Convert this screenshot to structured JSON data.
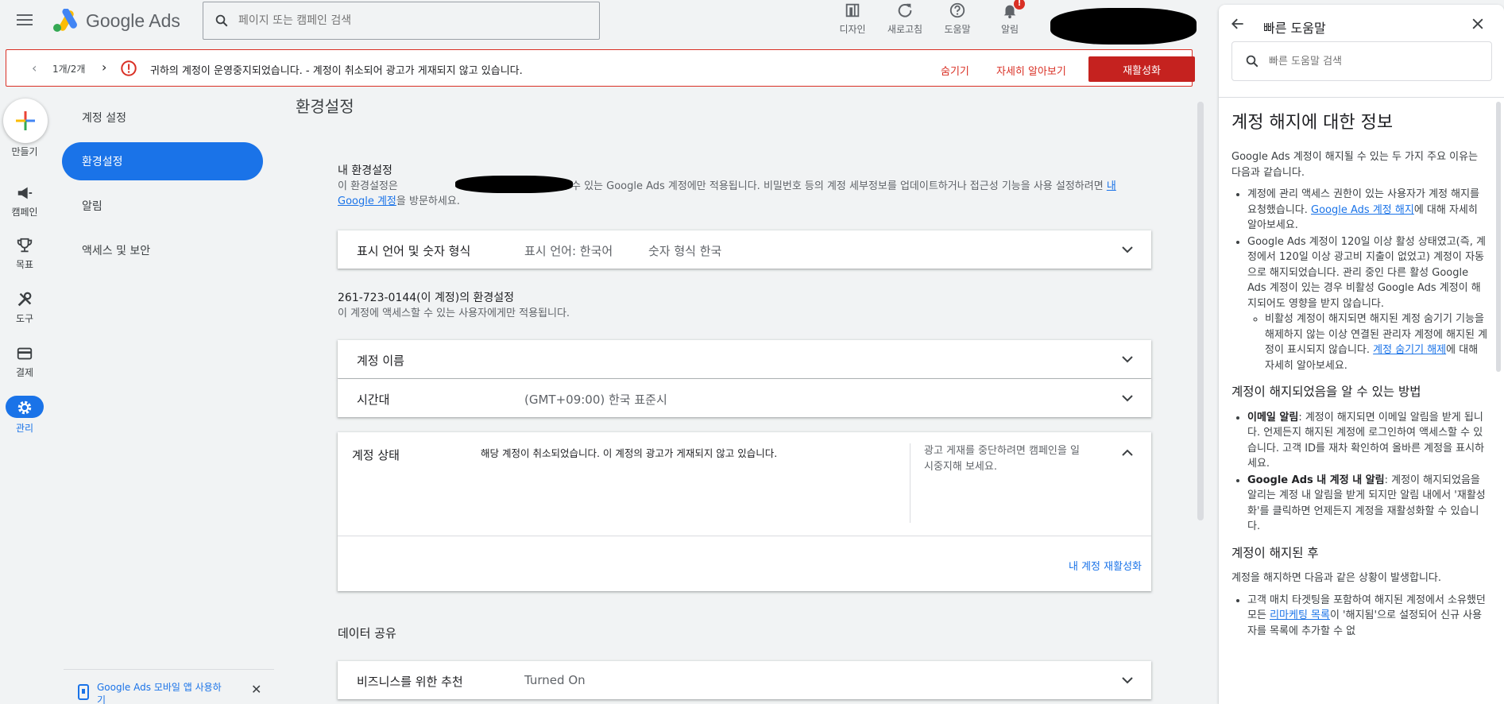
{
  "header": {
    "app_title": "Google Ads",
    "search_placeholder": "페이지 또는 캠페인 검색",
    "icons": [
      {
        "name": "appearance",
        "label": "디자인"
      },
      {
        "name": "refresh",
        "label": "새로고침"
      },
      {
        "name": "help",
        "label": "도움말"
      },
      {
        "name": "notifications",
        "label": "알림",
        "badge": "!"
      }
    ]
  },
  "alert": {
    "pager": "1개/2개",
    "message": "귀하의 계정이 운영중지되었습니다. - 계정이 취소되어 광고가 게재되지 않고 있습니다.",
    "hide": "숨기기",
    "learn_more": "자세히 알아보기",
    "reactivate": "재활성화"
  },
  "rail": {
    "create": "만들기",
    "campaigns": "캠페인",
    "goals": "목표",
    "tools": "도구",
    "billing": "결제",
    "admin": "관리"
  },
  "subnav": {
    "items": [
      {
        "label": "계정 설정"
      },
      {
        "label": "환경설정",
        "active": true
      },
      {
        "label": "알림"
      },
      {
        "label": "액세스 및 보안"
      }
    ],
    "promo": "Google Ads 모바일 앱 사용하기"
  },
  "main": {
    "title": "환경설정",
    "my_prefs_heading": "내 환경설정",
    "my_prefs_desc_a": "이 환경설정은",
    "my_prefs_desc_b": "서 액세스할 수 있는 Google Ads 계정에만 적용됩니다. 비밀번호 등의 계정 세부정보를 업데이트하거나 접근성 기능을 사용 설정하려면 ",
    "my_prefs_link": "내 Google 계정",
    "my_prefs_desc_c": "을 방문하세요.",
    "lang_row": {
      "title": "표시 언어 및 숫자 형식",
      "value1": "표시 언어: 한국어",
      "value2": "숫자 형식 한국"
    },
    "account_heading": "261-723-0144(이 계정)의 환경설정",
    "account_desc": "이 계정에 액세스할 수 있는 사용자에게만 적용됩니다.",
    "account_name_row": {
      "title": "계정 이름"
    },
    "timezone_row": {
      "title": "시간대",
      "value": "(GMT+09:00) 한국 표준시"
    },
    "status_card": {
      "title": "계정 상태",
      "message": "해당 계정이 취소되었습니다. 이 계정의 광고가 게재되지 않고 있습니다.",
      "hint": "광고 게재를 중단하려면 캠페인을 일시중지해 보세요.",
      "link": "내 계정 재활성화"
    },
    "data_sharing_heading": "데이터 공유",
    "biz_row": {
      "title": "비즈니스를 위한 추천",
      "value": "Turned On"
    }
  },
  "help": {
    "title": "빠른 도움말",
    "search_placeholder": "빠른 도움말 검색",
    "article_title": "계정 해지에 대한 정보",
    "intro": "Google Ads 계정이 해지될 수 있는 두 가지 주요 이유는 다음과 같습니다.",
    "reason1_a": "계정에 관리 액세스 권한이 있는 사용자가 계정 해지를 요청했습니다. ",
    "reason1_link": "Google Ads 계정 해지",
    "reason1_b": "에 대해 자세히 알아보세요.",
    "reason2": "Google Ads 계정이 120일 이상 활성 상태였고(즉, 계정에서 120일 이상 광고비 지출이 없었고) 계정이 자동으로 해지되었습니다. 관리 중인 다른 활성 Google Ads 계정이 있는 경우 비활성 Google Ads 계정이 해지되어도 영향을 받지 않습니다.",
    "reason2_sub_a": "비활성 계정이 해지되면 해지된 계정 숨기기 기능을 해제하지 않는 이상 연결된 관리자 계정에 해지된 계정이 표시되지 않습니다. ",
    "reason2_sub_link": "계정 숨기기 해제",
    "reason2_sub_b": "에 대해 자세히 알아보세요.",
    "h2_how": "계정이 해지되었음을 알 수 있는 방법",
    "how1_bold": "이메일 알림",
    "how1": ": 계정이 해지되면 이메일 알림을 받게 됩니다. 언제든지 해지된 계정에 로그인하여 액세스할 수 있습니다. 고객 ID를 재차 확인하여 올바른 계정을 표시하세요.",
    "how2_bold": "Google Ads 내 계정 내 알림",
    "how2": ": 계정이 해지되었음을 알리는 계정 내 알림을 받게 되지만 알림 내에서 '재활성화'를 클릭하면 언제든지 계정을 재활성화할 수 있습니다.",
    "h2_after": "계정이 해지된 후",
    "after_intro": "계정을 해지하면 다음과 같은 상황이 발생합니다.",
    "after1_a": "고객 매치 타겟팅을 포함하여 해지된 계정에서 소유했던 모든 ",
    "after1_link": "리마케팅 목록",
    "after1_b": "이 '해지됨'으로 설정되어 신규 사용자를 목록에 추가할 수 없"
  },
  "colors": {
    "accent": "#1a73e8",
    "danger": "#d93025",
    "reactivate_bg": "#c5221f"
  }
}
